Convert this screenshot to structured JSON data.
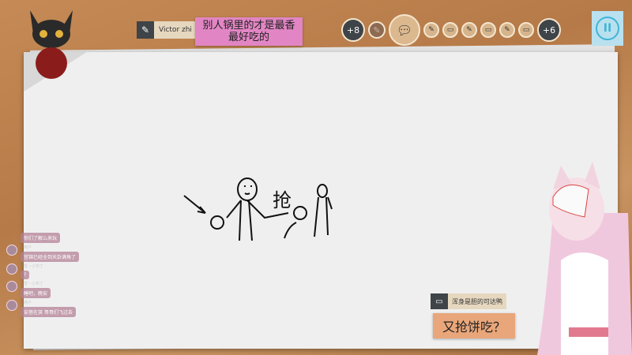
{
  "author": {
    "name": "Victor zhi",
    "icon": "brush-icon"
  },
  "prompt": "别人锅里的才是最香最好吃的",
  "timeline": {
    "left_more": "+8",
    "right_more": "+6",
    "current_icon": "speech-bubble-icon"
  },
  "pause_icon": "pause-icon",
  "chat": [
    {
      "user": "",
      "text": "你们了解么来玩"
    },
    {
      "user": "用户",
      "text": "宫锦已经全到天卦满角了"
    },
    {
      "user": "雪丶小布丁",
      "text": "?"
    },
    {
      "user": "雪丶小布丁",
      "text": "睡吧，晚安"
    },
    {
      "user": "用户",
      "text": "安蓓在哭 哥哥们飞过去"
    }
  ],
  "guess": {
    "name": "浑身是胆的可达鸭",
    "answer": "又抢饼吃？"
  },
  "drawing_text": "抢"
}
